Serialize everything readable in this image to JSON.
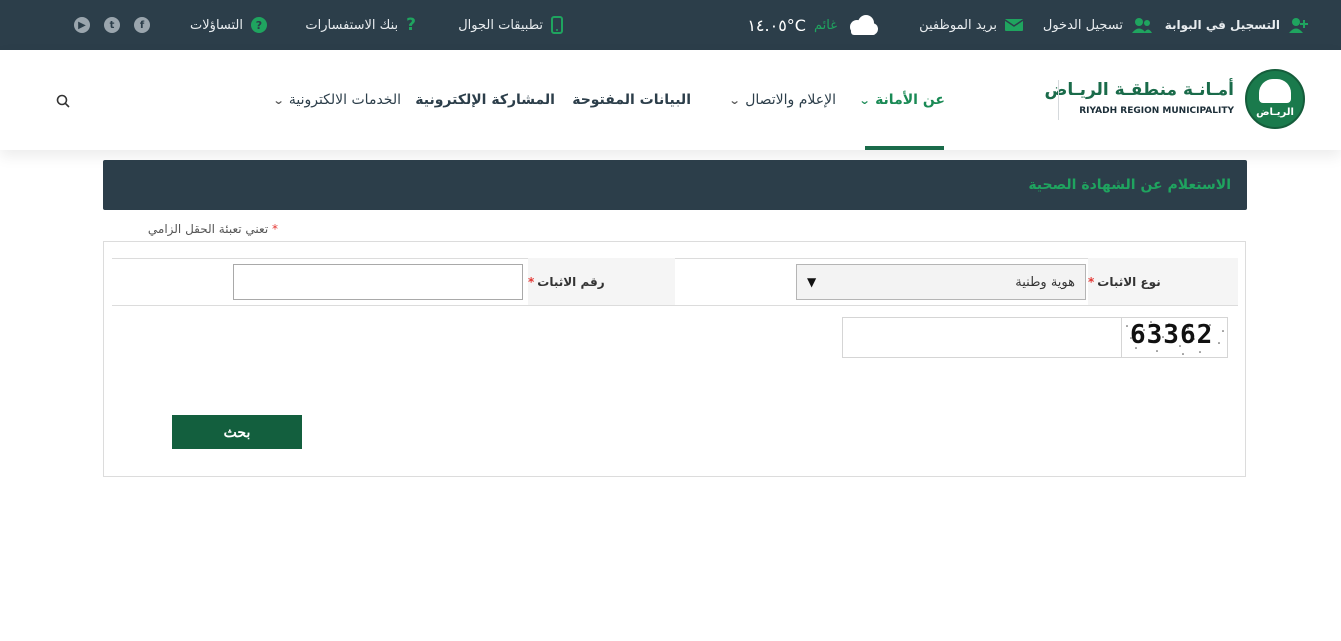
{
  "topbar": {
    "register_portal": "التسجيل في البوابة",
    "login": "تسجيل الدخول",
    "employee_mail": "بريد الموظفين",
    "weather_status": "غائم",
    "temperature": "١٤.٠٥°C",
    "mobile_apps": "تطبيقات الجوال",
    "inquiries_bank": "بنك الاستفسارات",
    "questions": "التساؤلات"
  },
  "brand": {
    "name_ar": "أمـانـة منطقـة الريـاض",
    "name_en": "RIYADH REGION MUNICIPALITY",
    "emblem_text": "الريـاض"
  },
  "nav": {
    "about": "عن الأمانة",
    "media": "الإعلام والاتصال",
    "open_data": "البيانات المفتوحة",
    "e_participation": "المشاركة الإلكترونية",
    "e_services": "الخدمات الالكترونية"
  },
  "page": {
    "title": "الاستعلام عن الشهادة الصحية",
    "required_note": "تعني تعبئة الحقل الزامي",
    "required_mark": "*"
  },
  "form": {
    "id_type_label": "نوع الاثبات",
    "id_type_value": "هوية وطنية",
    "id_number_label": "رقم الاثبات",
    "captcha_code": "63362",
    "search_button": "بحث"
  },
  "colors": {
    "topbar_bg": "#2c3e4a",
    "accent_green": "#1fa45f",
    "button_green": "#135f3e"
  }
}
